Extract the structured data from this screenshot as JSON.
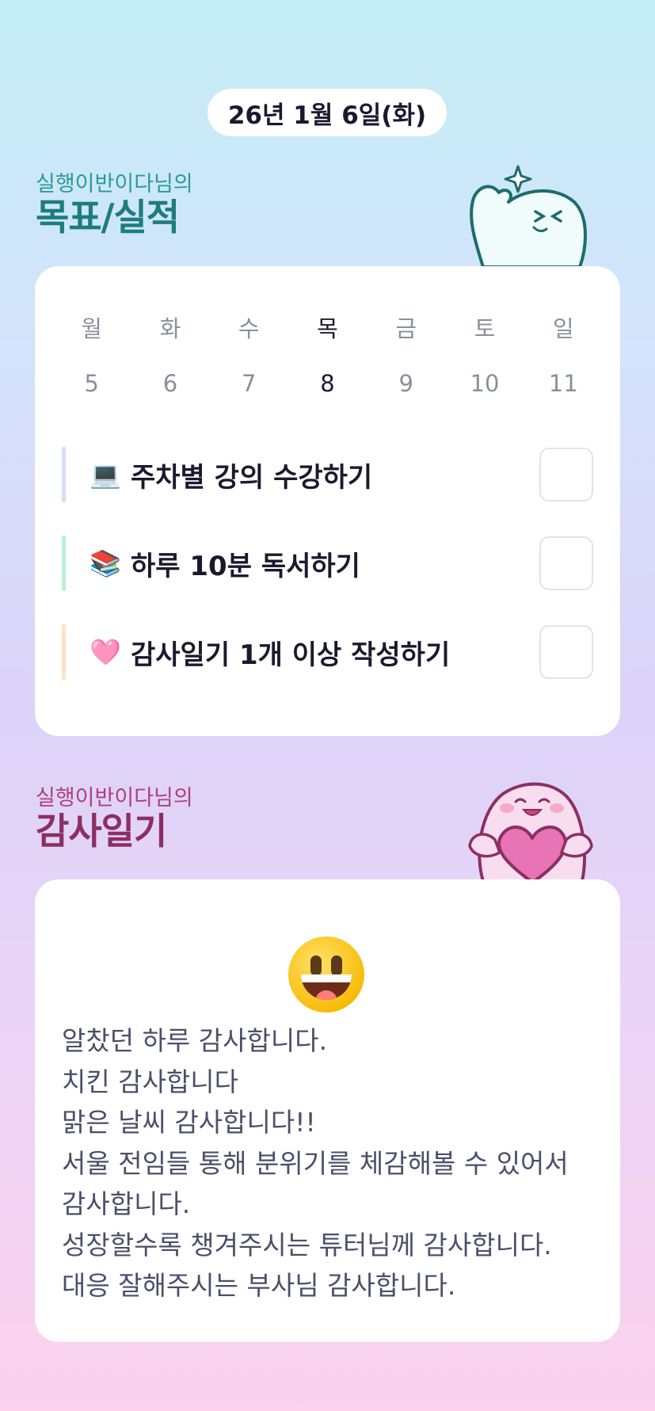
{
  "date": "26년 1월 6일(화)",
  "goals_section": {
    "subtitle": "실행이반이다님의",
    "title": "목표/실적"
  },
  "week": {
    "days": [
      "월",
      "화",
      "수",
      "목",
      "금",
      "토",
      "일"
    ],
    "dates": [
      "5",
      "6",
      "7",
      "8",
      "9",
      "10",
      "11"
    ],
    "active_index": 3
  },
  "goals": [
    {
      "emoji": "💻",
      "text": "주차별 강의 수강하기",
      "bar_color": "#d7def8",
      "checked": false
    },
    {
      "emoji": "📚",
      "text": "하루 10분 독서하기",
      "bar_color": "#b9f0d7",
      "checked": false
    },
    {
      "emoji": "🩷",
      "text": "감사일기 1개 이상 작성하기",
      "bar_color": "#fde2c2",
      "checked": false
    }
  ],
  "diary_section": {
    "subtitle": "실행이반이다님의",
    "title": "감사일기"
  },
  "diary": {
    "mood_icon": "grinning-face-icon",
    "lines": [
      "알찼던 하루 감사합니다.",
      "치킨 감사합니다",
      "맑은 날씨 감사합니다!!",
      "서울 전임들 통해 분위기를 체감해볼 수 있어서",
      "감사합니다.",
      "성장할수록 챙겨주시는 튜터님께 감사합니다.",
      "대응 잘해주시는 부사님 감사합니다."
    ]
  },
  "colors": {
    "teal_title": "#1d7c7f",
    "plum_title": "#8c2f63"
  }
}
